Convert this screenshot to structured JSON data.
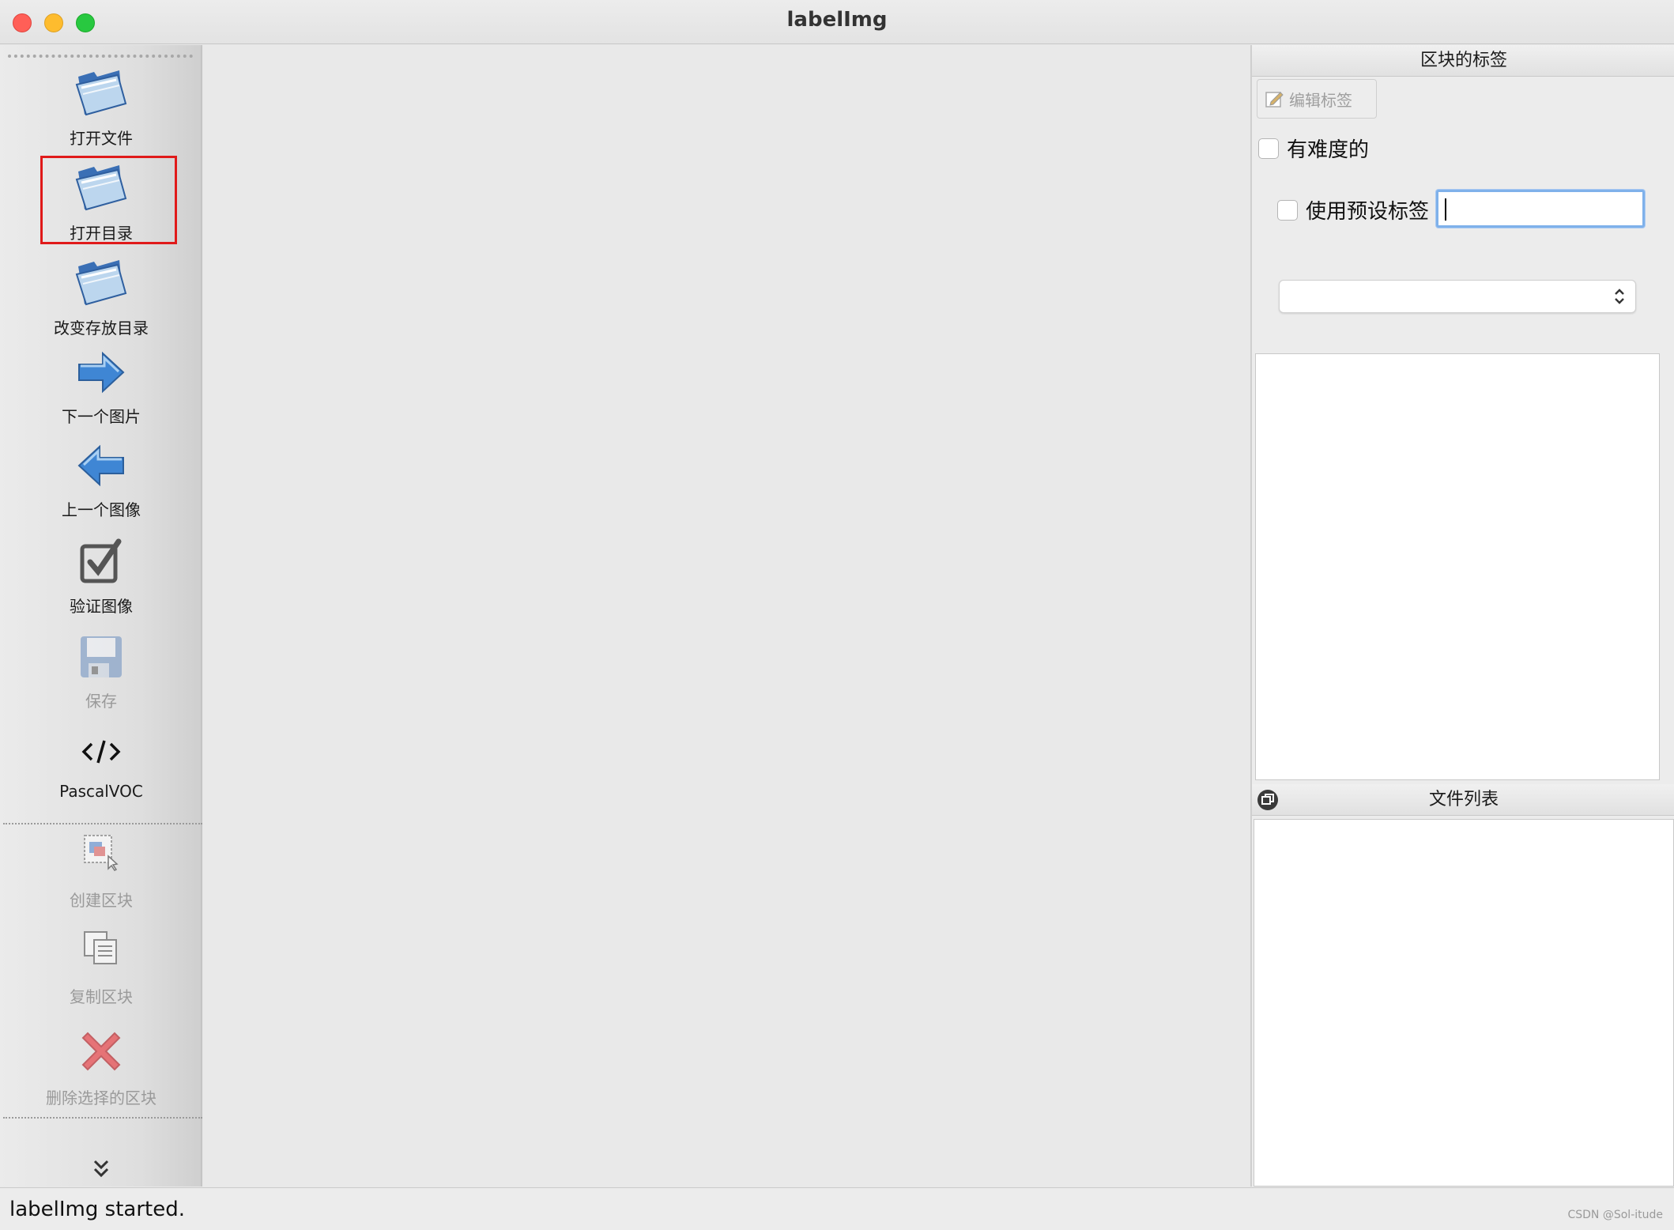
{
  "window": {
    "title": "labelImg",
    "controls": {
      "close_color": "#ff5f57",
      "minimize_color": "#febc2e",
      "zoom_color": "#28c840"
    }
  },
  "toolbar": {
    "items": [
      {
        "label": "打开文件",
        "icon": "folder-open-icon",
        "enabled": true
      },
      {
        "label": "打开目录",
        "icon": "folder-open-icon",
        "enabled": true,
        "highlighted": true
      },
      {
        "label": "改变存放目录",
        "icon": "folder-open-icon",
        "enabled": true
      },
      {
        "label": "下一个图片",
        "icon": "arrow-right-icon",
        "enabled": true
      },
      {
        "label": "上一个图像",
        "icon": "arrow-left-icon",
        "enabled": true
      },
      {
        "label": "验证图像",
        "icon": "checkbox-checked-icon",
        "enabled": true
      },
      {
        "label": "保存",
        "icon": "floppy-disk-icon",
        "enabled": false
      },
      {
        "label": "PascalVOC",
        "icon": "code-icon",
        "enabled": true
      },
      {
        "label": "创建区块",
        "icon": "create-box-icon",
        "enabled": false
      },
      {
        "label": "复制区块",
        "icon": "copy-box-icon",
        "enabled": false
      },
      {
        "label": "删除选择的区块",
        "icon": "delete-x-icon",
        "enabled": false
      }
    ],
    "expand_icon": "double-chevron-down-icon"
  },
  "dock": {
    "labels_panel": {
      "title": "区块的标签",
      "edit_button": "编辑标签",
      "difficult_checkbox": "有难度的",
      "default_label_checkbox": "使用预设标签",
      "default_label_value": "",
      "combo_value": ""
    },
    "file_panel": {
      "title": "文件列表"
    }
  },
  "status": {
    "text": "labelImg started.",
    "watermark": "CSDN @Sol-itude"
  },
  "colors": {
    "highlight_border": "#e01a1a",
    "input_focus": "#7fb1ea"
  }
}
